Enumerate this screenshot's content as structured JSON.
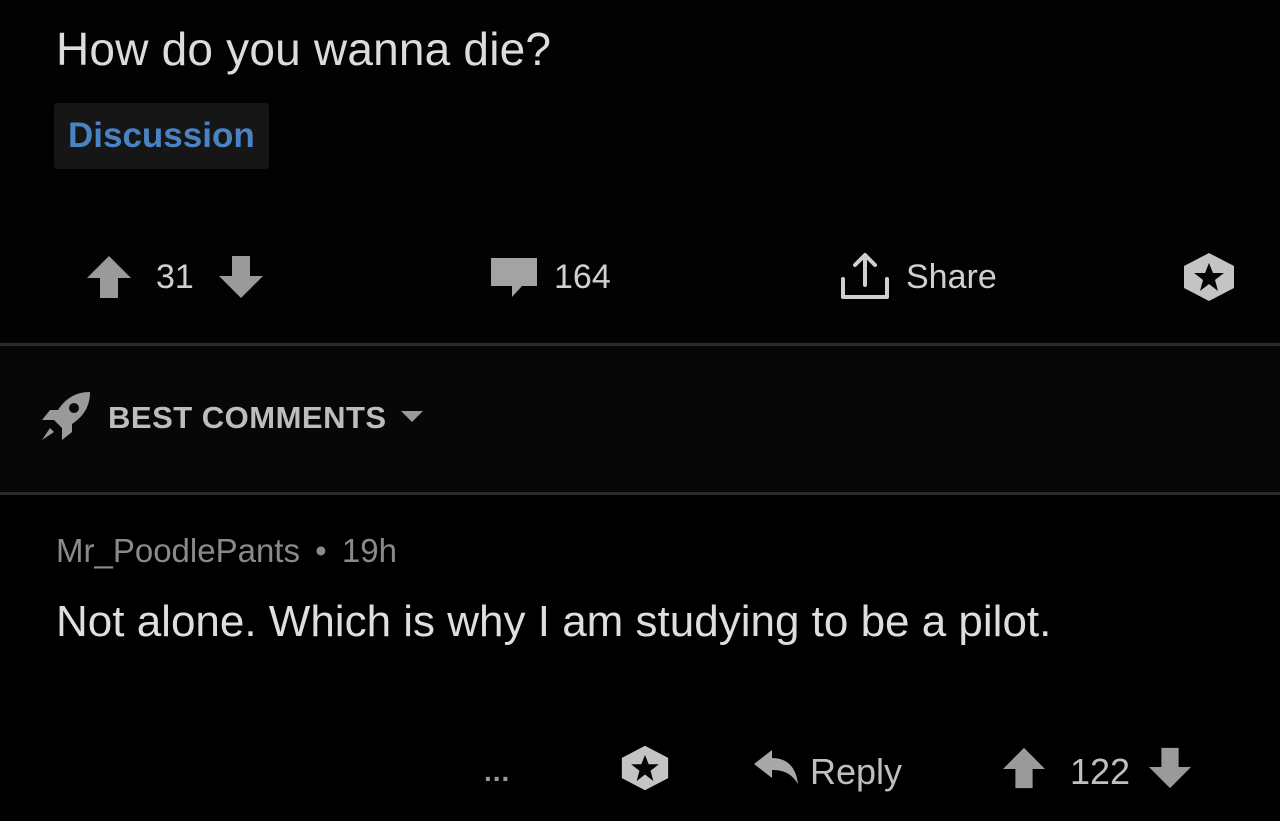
{
  "post": {
    "title": "How do you wanna die?",
    "flair": "Discussion",
    "score": "31",
    "comment_count": "164",
    "share_label": "Share"
  },
  "sort": {
    "label": "BEST COMMENTS"
  },
  "comment": {
    "author": "Mr_PoodlePants",
    "separator": "•",
    "age": "19h",
    "body": "Not alone.  Which is why I am studying to be a pilot.",
    "more_label": "...",
    "reply_label": "Reply",
    "score": "122"
  },
  "colors": {
    "background": "#000000",
    "flair_text": "#4a83c4",
    "text": "#d7d7d7",
    "muted": "#8a8a8a"
  }
}
